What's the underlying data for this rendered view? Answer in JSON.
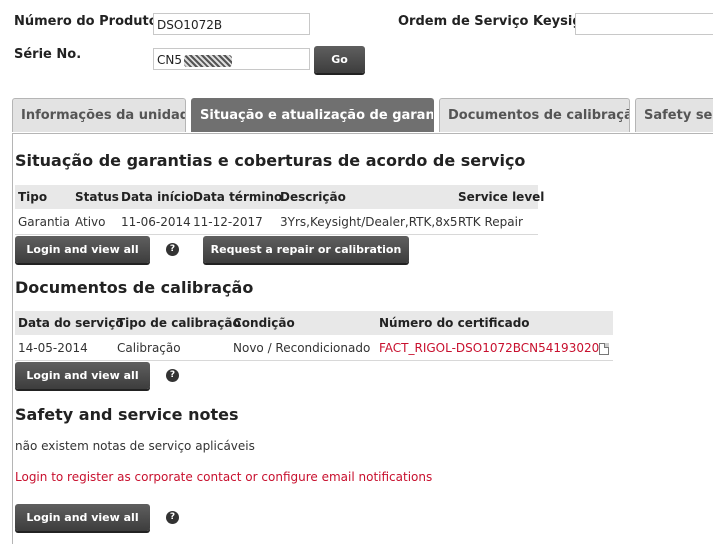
{
  "product_form": {
    "product_label": "Número do Produto",
    "product_value": "DSO1072B",
    "serial_label": "Série No.",
    "serial_value": "CN5",
    "service_order_label": "Ordem de Serviço Keysight",
    "service_order_value": "",
    "go_label": "Go"
  },
  "tabs": [
    {
      "label": "Informações da unidade",
      "active": false
    },
    {
      "label": "Situação e atualização de garantia",
      "active": true
    },
    {
      "label": "Documentos de calibração",
      "active": false
    },
    {
      "label": "Safety serv",
      "active": false
    }
  ],
  "warranty": {
    "title": "Situação de garantias e coberturas de acordo de serviço",
    "headers": [
      "Tipo",
      "Status",
      "Data início",
      "Data término",
      "Descrição",
      "Service level"
    ],
    "rows": [
      [
        "Garantia",
        "Ativo",
        "11-06-2014",
        "11-12-2017",
        "3Yrs,Keysight/Dealer,RTK,8x5",
        "RTK Repair"
      ]
    ],
    "login_label": "Login and view all",
    "repair_label": "Request a repair or calibration"
  },
  "calibration": {
    "title": "Documentos de calibração",
    "headers": [
      "Data do serviço",
      "Tipo de calibração",
      "Condição",
      "Número do certificado"
    ],
    "rows": [
      [
        "14-05-2014",
        "Calibração",
        "Novo / Recondicionado",
        "FACT_RIGOL-DSO1072BCN54193020"
      ]
    ],
    "login_label": "Login and view all"
  },
  "safety": {
    "title": "Safety and service notes",
    "empty_text": "não existem notas de serviço aplicáveis",
    "register_link": "Login to register as corporate contact or configure email notifications",
    "login_label": "Login and view all"
  },
  "help_glyph": "?",
  "colors": {
    "accent_red": "#c8102e",
    "button": "#4a4a4a",
    "active_tab": "#707070"
  }
}
